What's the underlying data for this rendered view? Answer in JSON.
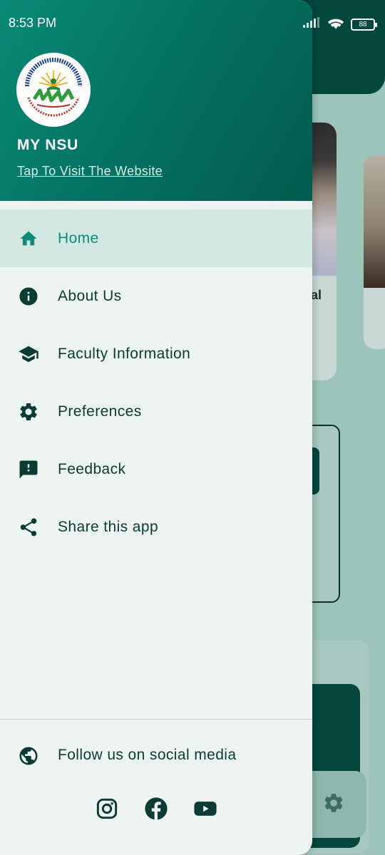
{
  "status_bar": {
    "time": "8:53 PM",
    "battery": "88"
  },
  "drawer": {
    "app_title": "MY NSU",
    "visit_link": "Tap To Visit The Website",
    "logo_alt": "NATIONAL SKILLS UNIVERSITY ISLAMABAD",
    "menu": [
      {
        "label": "Home",
        "icon": "home-icon",
        "active": true
      },
      {
        "label": "About Us",
        "icon": "info-icon",
        "active": false
      },
      {
        "label": "Faculty Information",
        "icon": "graduation-cap-icon",
        "active": false
      },
      {
        "label": "Preferences",
        "icon": "gear-icon",
        "active": false
      },
      {
        "label": "Feedback",
        "icon": "feedback-icon",
        "active": false
      },
      {
        "label": "Share this app",
        "icon": "share-icon",
        "active": false
      }
    ],
    "follow_label": "Follow us on social media",
    "socials": [
      "instagram-icon",
      "facebook-icon",
      "youtube-icon"
    ]
  },
  "background": {
    "card_text_fragment": "al"
  },
  "colors": {
    "header_dark": "#03473d",
    "accent": "#0f8a78",
    "drawer_bg": "#eef4f1",
    "active_bg": "#d4e8e3",
    "text": "#0a3b35"
  }
}
